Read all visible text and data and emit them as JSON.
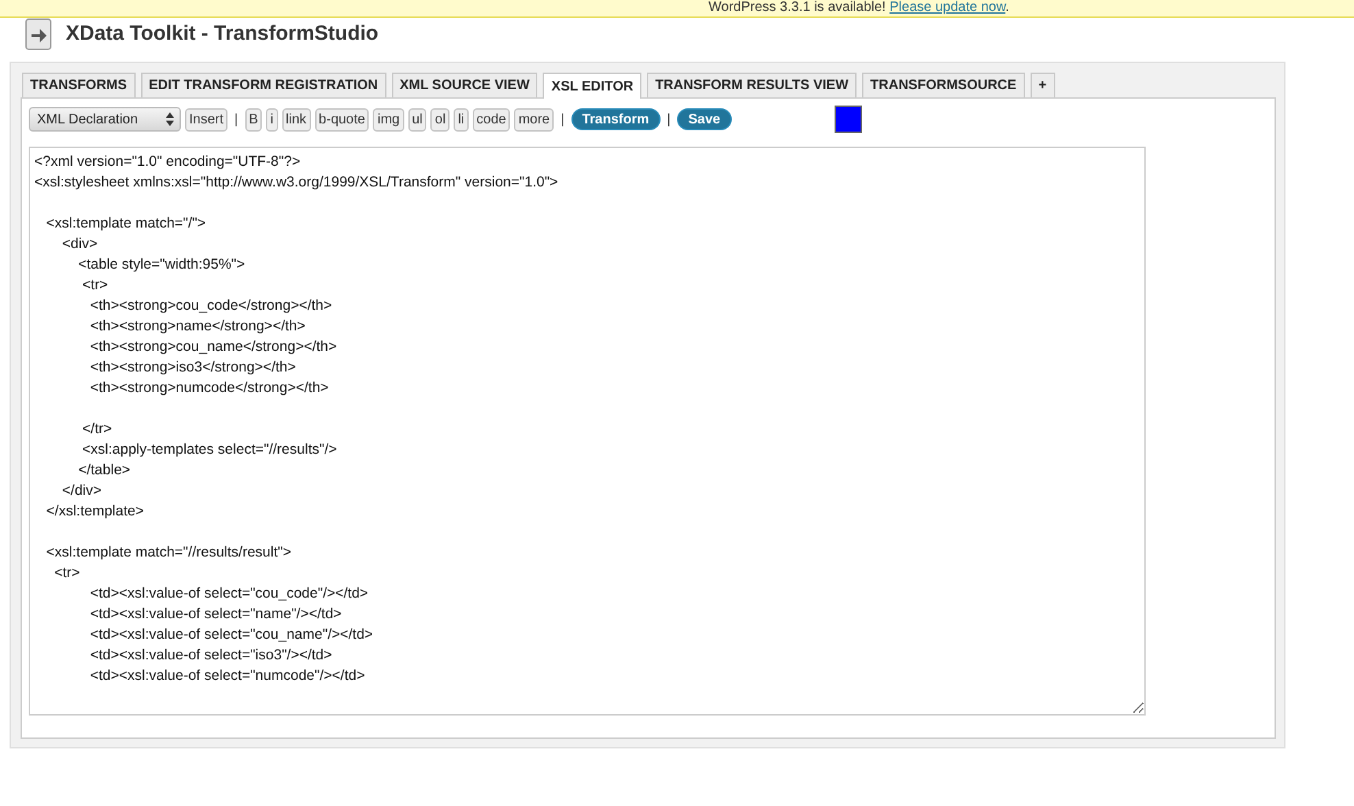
{
  "notice": {
    "text": "WordPress 3.3.1 is available!",
    "link": "Please update now",
    "end": "."
  },
  "page_title": "XData Toolkit - TransformStudio",
  "tabs": [
    {
      "label": "TRANSFORMS",
      "selected": false
    },
    {
      "label": "EDIT TRANSFORM REGISTRATION",
      "selected": false
    },
    {
      "label": "XML SOURCE VIEW",
      "selected": false
    },
    {
      "label": "XSL EDITOR",
      "selected": true
    },
    {
      "label": "TRANSFORM RESULTS VIEW",
      "selected": false
    },
    {
      "label": "TRANSFORMSOURCE",
      "selected": false
    },
    {
      "label": "+",
      "selected": false
    }
  ],
  "toolbar": [
    {
      "kind": "select",
      "label": "XML Declaration"
    },
    {
      "kind": "button",
      "label": "Insert"
    },
    {
      "kind": "separator",
      "label": "|"
    },
    {
      "kind": "button",
      "label": "B"
    },
    {
      "kind": "button",
      "label": "i"
    },
    {
      "kind": "button",
      "label": "link"
    },
    {
      "kind": "button",
      "label": "b-quote"
    },
    {
      "kind": "button",
      "label": "img"
    },
    {
      "kind": "button",
      "label": "ul"
    },
    {
      "kind": "button",
      "label": "ol"
    },
    {
      "kind": "button",
      "label": "li"
    },
    {
      "kind": "button",
      "label": "code"
    },
    {
      "kind": "button",
      "label": "more"
    },
    {
      "kind": "separator",
      "label": "|"
    },
    {
      "kind": "primary",
      "label": "Transform"
    },
    {
      "kind": "separator",
      "label": "|"
    },
    {
      "kind": "primary",
      "label": "Save"
    },
    {
      "kind": "swatch"
    }
  ],
  "editor": {
    "value": "<?xml version=\"1.0\" encoding=\"UTF-8\"?>\n<xsl:stylesheet xmlns:xsl=\"http://www.w3.org/1999/XSL/Transform\" version=\"1.0\">\n\n   <xsl:template match=\"/\">\n       <div>\n           <table style=\"width:95%\">\n            <tr>\n              <th><strong>cou_code</strong></th>\n              <th><strong>name</strong></th>\n              <th><strong>cou_name</strong></th>\n              <th><strong>iso3</strong></th>\n              <th><strong>numcode</strong></th>\n\n            </tr>\n            <xsl:apply-templates select=\"//results\"/>\n           </table>\n       </div>\n   </xsl:template>\n\n   <xsl:template match=\"//results/result\">\n     <tr>\n              <td><xsl:value-of select=\"cou_code\"/></td>\n              <td><xsl:value-of select=\"name\"/></td>\n              <td><xsl:value-of select=\"cou_name\"/></td>\n              <td><xsl:value-of select=\"iso3\"/></td>\n              <td><xsl:value-of select=\"numcode\"/></td>\n"
  }
}
